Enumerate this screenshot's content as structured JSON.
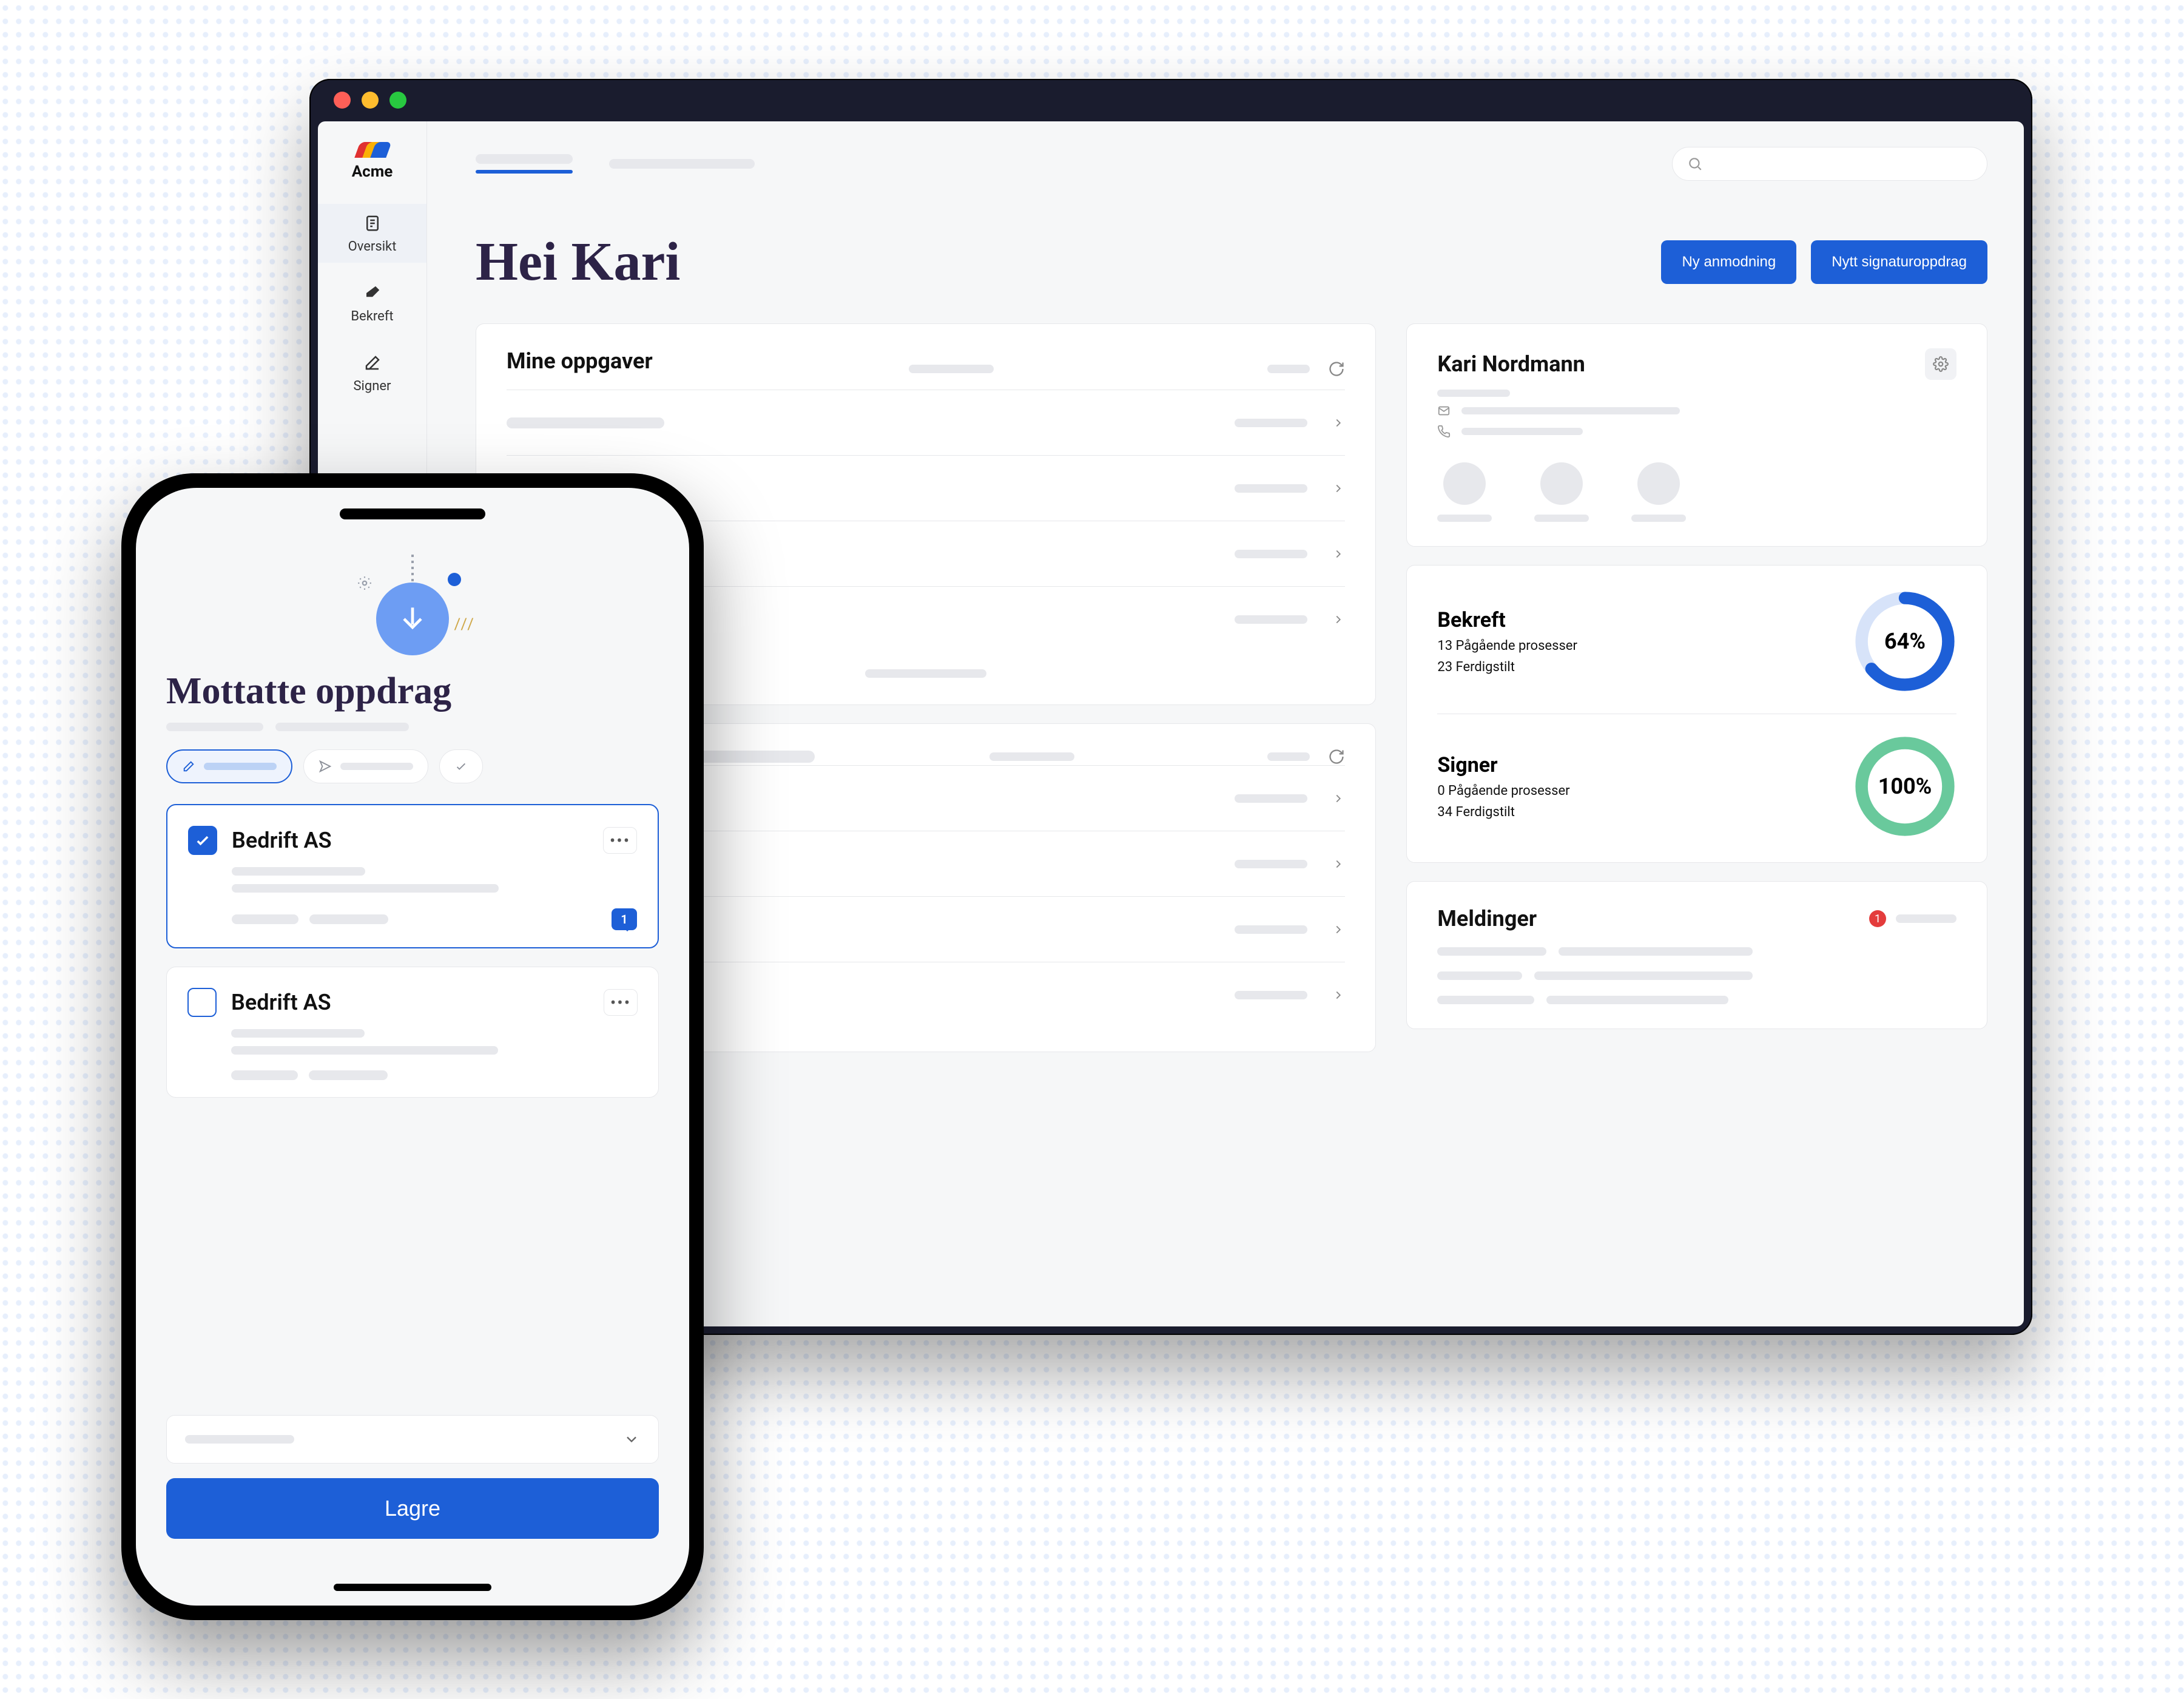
{
  "brand": {
    "name": "Acme"
  },
  "sidebar": {
    "items": [
      {
        "label": "Oversikt",
        "icon": "list-icon",
        "active": true
      },
      {
        "label": "Bekreft",
        "icon": "eraser-icon",
        "active": false
      },
      {
        "label": "Signer",
        "icon": "pen-icon",
        "active": false
      }
    ]
  },
  "header": {
    "greeting": "Hei Kari",
    "buttons": {
      "new_request": "Ny anmodning",
      "new_signature": "Nytt signaturoppdrag"
    }
  },
  "tasks_card": {
    "title": "Mine oppgaver"
  },
  "profile": {
    "name": "Kari Nordmann"
  },
  "progress": {
    "bekreft": {
      "title": "Bekreft",
      "ongoing": "13 Pågående prosesser",
      "done": "23 Ferdigstilt",
      "percent": 64,
      "percent_label": "64%",
      "color": "#1d5fd7",
      "track": "#d7e3f9"
    },
    "signer": {
      "title": "Signer",
      "ongoing": "0 Pågående prosesser",
      "done": "34 Ferdigstilt",
      "percent": 100,
      "percent_label": "100%",
      "color": "#69c99c",
      "track": "#dff3e9"
    }
  },
  "messages": {
    "title": "Meldinger",
    "unread": "1"
  },
  "mobile": {
    "title": "Mottatte oppdrag",
    "tasks": [
      {
        "company": "Bedrift AS",
        "checked": true,
        "comments": "1"
      },
      {
        "company": "Bedrift AS",
        "checked": false
      }
    ],
    "save": "Lagre"
  },
  "chart_data": [
    {
      "type": "pie",
      "title": "Bekreft",
      "values": [
        64,
        36
      ],
      "categories": [
        "done",
        "remaining"
      ],
      "percent_label": "64%"
    },
    {
      "type": "pie",
      "title": "Signer",
      "values": [
        100,
        0
      ],
      "categories": [
        "done",
        "remaining"
      ],
      "percent_label": "100%"
    }
  ]
}
